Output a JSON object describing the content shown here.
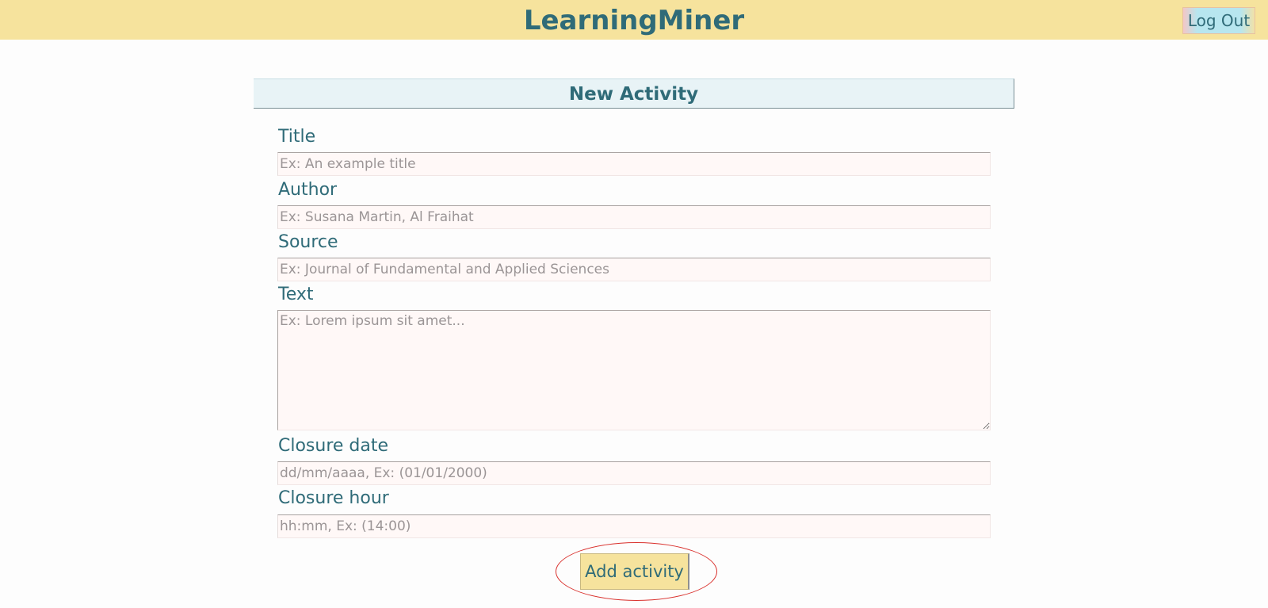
{
  "header": {
    "app_title": "LearningMiner",
    "logout_label": "Log Out"
  },
  "form": {
    "heading": "New Activity",
    "fields": [
      {
        "label": "Title",
        "value": "",
        "placeholder": "Ex: An example title"
      },
      {
        "label": "Author",
        "value": "",
        "placeholder": "Ex: Susana Martin, Al Fraihat"
      },
      {
        "label": "Source",
        "value": "",
        "placeholder": "Ex: Journal of Fundamental and Applied Sciences"
      },
      {
        "label": "Text",
        "value": "",
        "placeholder": "Ex: Lorem ipsum sit amet..."
      },
      {
        "label": "Closure date",
        "value": "",
        "placeholder": "dd/mm/aaaa, Ex: (01/01/2000)"
      },
      {
        "label": "Closure hour",
        "value": "",
        "placeholder": "hh:mm, Ex: (14:00)"
      }
    ],
    "submit_label": "Add activity"
  },
  "colors": {
    "topbar": "#f6e39d",
    "accent_text": "#2f6b78",
    "header_band": "#e8f3f6",
    "input_bg": "#fff8f7",
    "highlight_ring": "#d9302c"
  }
}
